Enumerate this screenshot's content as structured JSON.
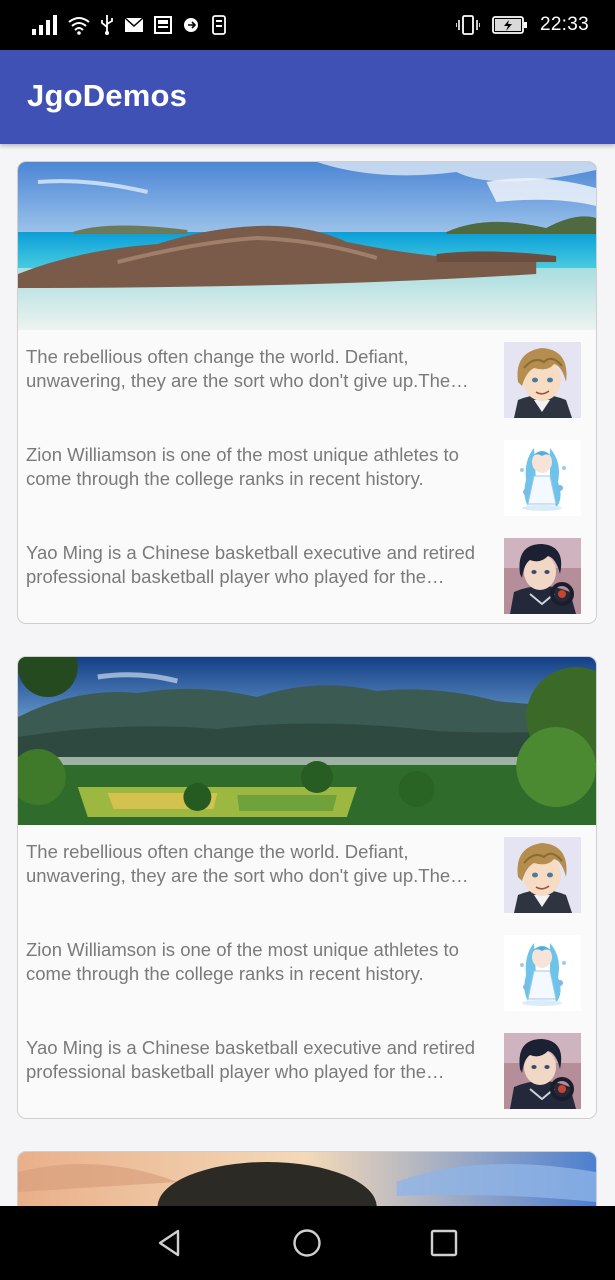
{
  "status_bar": {
    "time": "22:33",
    "left_icons": [
      "signal-icon",
      "wifi-icon",
      "usb-icon",
      "mail-icon",
      "news-icon",
      "sync-icon",
      "storage-icon"
    ],
    "right_icons": [
      "vibrate-icon",
      "battery-charging-icon"
    ]
  },
  "app_bar": {
    "title": "JgoDemos",
    "color": "#3f51b5"
  },
  "cards": [
    {
      "banner": "beach-rocks-image",
      "items": [
        {
          "text": "The rebellious often change the world. Defiant, unwavering, they are the sort who don't give up.The rebellious often change the world.",
          "avatar": "blond-boy-avatar"
        },
        {
          "text": "Zion Williamson is one of the most unique athletes to come through the college ranks in recent history.",
          "avatar": "blue-hair-girl-avatar"
        },
        {
          "text": "Yao Ming is a Chinese basketball executive and retired professional basketball player who played for the Houston Rockets.",
          "avatar": "dark-hair-boy-avatar"
        }
      ]
    },
    {
      "banner": "mountain-valley-image",
      "items": [
        {
          "text": "The rebellious often change the world. Defiant, unwavering, they are the sort who don't give up.The rebellious often change the world.",
          "avatar": "blond-boy-avatar"
        },
        {
          "text": "Zion Williamson is one of the most unique athletes to come through the college ranks in recent history.",
          "avatar": "blue-hair-girl-avatar"
        },
        {
          "text": "Yao Ming is a Chinese basketball executive and retired professional basketball player who played for the Houston Rockets.",
          "avatar": "dark-hair-boy-avatar"
        }
      ]
    },
    {
      "banner": "tree-sunset-image",
      "items": []
    }
  ],
  "nav_bar": {
    "buttons": [
      "back-icon",
      "home-icon",
      "recents-icon"
    ]
  }
}
